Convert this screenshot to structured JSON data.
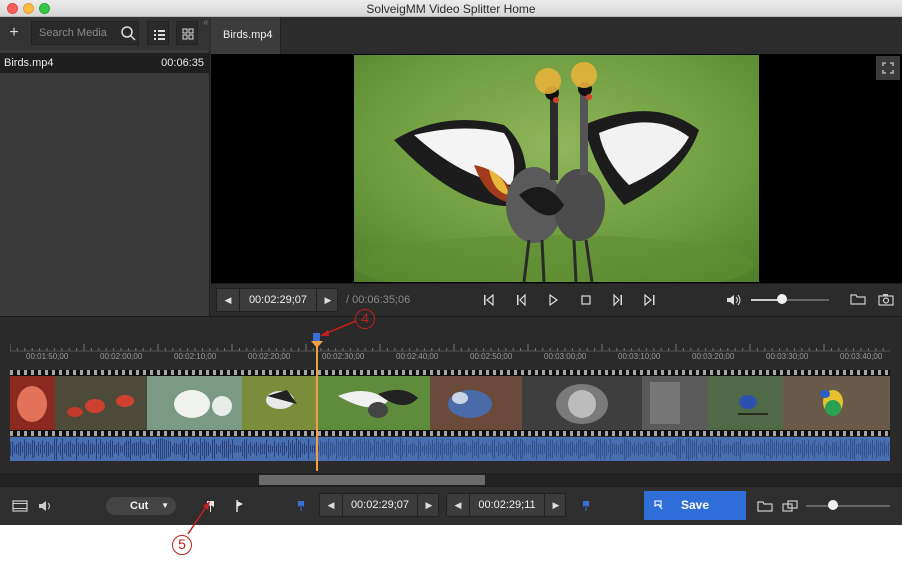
{
  "window": {
    "title": "SolveigMM Video Splitter Home"
  },
  "media_panel": {
    "search_placeholder": "Search Media",
    "items": [
      {
        "name": "Birds.mp4",
        "duration": "00:06:35"
      }
    ]
  },
  "tabs": [
    {
      "label": "Birds.mp4"
    }
  ],
  "player": {
    "current_time": "00:02:29;07",
    "total_time": "/ 00:06:35;06",
    "volume": 0.4
  },
  "timeline": {
    "ticks": [
      "00:01:50;00",
      "00:02:00;00",
      "00:02:10;00",
      "00:02:20;00",
      "00:02:30;00",
      "00:02:40;00",
      "00:02:50;00",
      "00:03:00;00",
      "00:03:10;00",
      "00:03:20;00",
      "00:03:30;00",
      "00:03:40;00"
    ],
    "playhead_time": "00:02:29;07",
    "scroll_fraction": 0.3
  },
  "annotations": {
    "callout_4": "4",
    "callout_5": "5"
  },
  "bottom_toolbar": {
    "mode": "Cut",
    "marker_in_time": "00:02:29;07",
    "marker_out_time": "00:02:29;11",
    "save_label": "Save",
    "zoom": 0.3
  },
  "colors": {
    "accent": "#2f6ed8",
    "playhead": "#f0a040",
    "waveform": "#4a6fb0",
    "annotation": "#c0201f"
  },
  "icons": [
    "plus-icon",
    "search-icon",
    "list-view-icon",
    "grid-view-icon",
    "fullscreen-icon",
    "step-back-icon",
    "frame-back-icon",
    "play-icon",
    "stop-icon",
    "frame-forward-icon",
    "step-forward-icon",
    "volume-icon",
    "folder-icon",
    "camera-icon",
    "filmstrip-icon",
    "audio-icon",
    "marker-in-icon",
    "marker-out-icon",
    "marker-icon",
    "save-icon",
    "window-icon"
  ]
}
